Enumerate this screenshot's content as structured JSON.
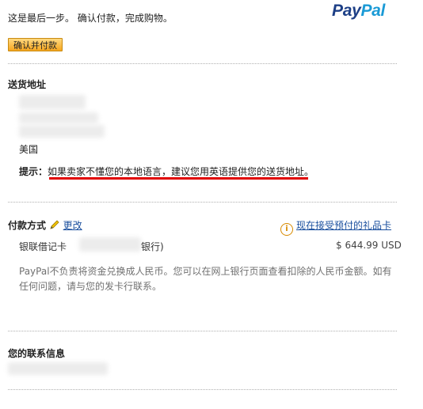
{
  "header": {
    "intro_text": "这是最后一步。 确认付款，完成购物。",
    "logo_part1": "Pay",
    "logo_part2": "Pal",
    "confirm_button_label": "确认并付款"
  },
  "shipping": {
    "title": "送货地址",
    "country": "美国",
    "tip_label": "提示：",
    "tip_text": "如果卖家不懂您的本地语言，建议您用英语提供您的送货地址。"
  },
  "payment": {
    "title": "付款方式",
    "edit_link": "更改",
    "gift_card_link": "现在接受预付的礼品卡",
    "card_label": "银联借记卡",
    "card_suffix": "银行)",
    "amount": "$ 644.99 USD",
    "note": "PayPal不负责将资金兑换成人民币。您可以在网上银行页面查看扣除的人民币金额。如有任何问题，请与您的发卡行联系。"
  },
  "contact": {
    "title": "您的联系信息"
  },
  "colors": {
    "link": "#1a4f9e",
    "button": "#f6a51e",
    "highlight_underline": "#e00000"
  },
  "icons": [
    "pencil-icon",
    "info-icon"
  ]
}
